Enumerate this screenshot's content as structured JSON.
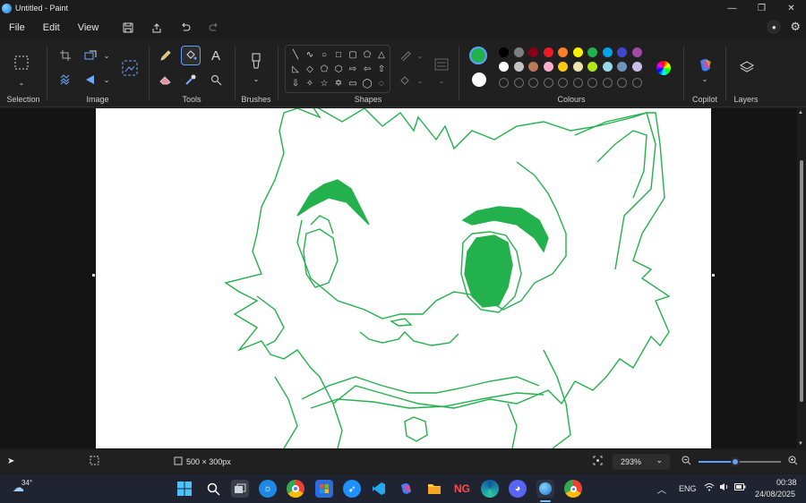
{
  "window": {
    "title": "Untitled - Paint",
    "minimize_glyph": "—",
    "restore_glyph": "❐",
    "close_glyph": "✕"
  },
  "menu": {
    "items": [
      "File",
      "Edit",
      "View"
    ]
  },
  "ribbon": {
    "groups": {
      "selection": "Selection",
      "image": "Image",
      "tools": "Tools",
      "brushes": "Brushes",
      "shapes": "Shapes",
      "colours": "Colours",
      "copilot": "Copilot",
      "layers": "Layers"
    },
    "active_tool": "fill-tool",
    "primary_color": "#22b14c",
    "secondary_color": "#ffffff",
    "palette_row1": [
      "#000000",
      "#7f7f7f",
      "#880015",
      "#ed1c24",
      "#ff7f27",
      "#fff200",
      "#22b14c",
      "#00a2e8",
      "#3f48cc",
      "#a349a4"
    ],
    "palette_row2": [
      "#ffffff",
      "#c3c3c3",
      "#b97a57",
      "#ffaec9",
      "#ffc90e",
      "#efe4b0",
      "#b5e61d",
      "#99d9ea",
      "#7092be",
      "#c8bfe7"
    ]
  },
  "canvas": {
    "stroke_color": "#22b14c",
    "background": "#ffffff"
  },
  "status": {
    "canvas_size": "500 × 300px",
    "zoom": "293%",
    "zoom_level": 0.45
  },
  "taskbar": {
    "weather_temp": "34°",
    "language": "ENG",
    "time": "00:38",
    "date": "24/08/2025"
  }
}
